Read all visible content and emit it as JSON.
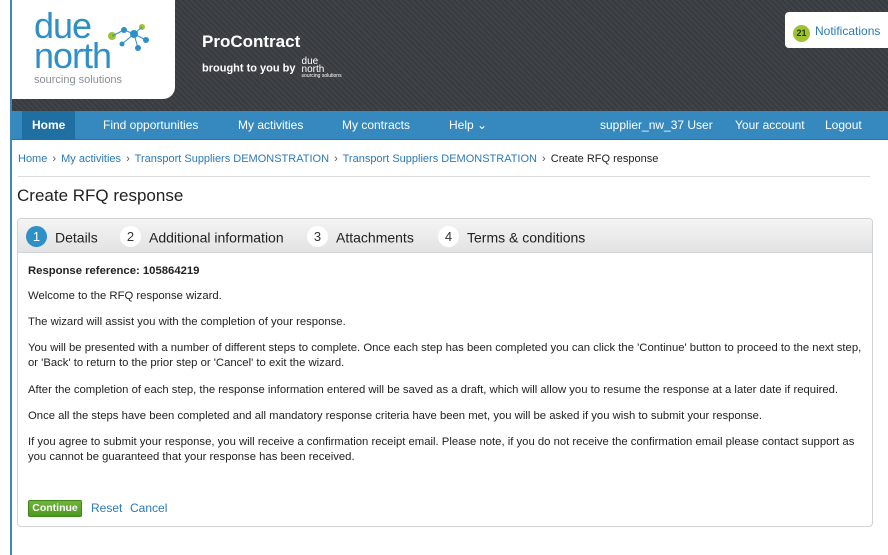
{
  "logo": {
    "line1": "due",
    "line2": "north",
    "tagline": "sourcing solutions"
  },
  "brand": {
    "title": "ProContract",
    "subtitle": "brought to you by",
    "sub_logo_line1": "due",
    "sub_logo_line2": "north",
    "sub_logo_tag": "sourcing solutions"
  },
  "notifications": {
    "count": "21",
    "label": "Notifications"
  },
  "nav": {
    "items": [
      {
        "label": "Home"
      },
      {
        "label": "Find opportunities"
      },
      {
        "label": "My activities"
      },
      {
        "label": "My contracts"
      },
      {
        "label": "Help ⌄"
      }
    ],
    "user": "supplier_nw_37 User",
    "account": "Your account",
    "logout": "Logout"
  },
  "breadcrumb": {
    "items": [
      "Home",
      "My activities",
      "Transport Suppliers DEMONSTRATION",
      "Transport Suppliers DEMONSTRATION"
    ],
    "separator": "›",
    "current": "Create RFQ response"
  },
  "page": {
    "title": "Create RFQ response"
  },
  "wizard": {
    "steps": [
      {
        "num": "1",
        "label": "Details"
      },
      {
        "num": "2",
        "label": "Additional information"
      },
      {
        "num": "3",
        "label": "Attachments"
      },
      {
        "num": "4",
        "label": "Terms & conditions"
      }
    ],
    "reference": "Response reference: 105864219",
    "paragraphs": [
      "Welcome to the RFQ response wizard.",
      "The wizard will assist you with the completion of your response.",
      "You will be presented with a number of different steps to complete. Once each step has been completed you can click the 'Continue' button to proceed to the next step, or 'Back' to return to the prior step or 'Cancel' to exit the wizard.",
      "After the completion of each step, the response information entered will be saved as a draft, which will allow you to resume the response at a later date if required.",
      "Once all the steps have been completed and all mandatory response criteria have been met, you will be asked if you wish to submit your response.",
      "If you agree to submit your response, you will receive a confirmation receipt email. Please note, if you do not receive the confirmation email please contact support as you cannot be guaranteed that your response has been received."
    ],
    "continue_label": "Continue",
    "reset_label": "Reset",
    "cancel_label": "Cancel"
  },
  "colors": {
    "header_bg": "#3a3d42",
    "nav_bg": "#3589be",
    "link": "#2a7ab8",
    "active_step": "#2f8fc7",
    "continue_button": "#5aa62a",
    "notification_badge": "#9ec331"
  }
}
